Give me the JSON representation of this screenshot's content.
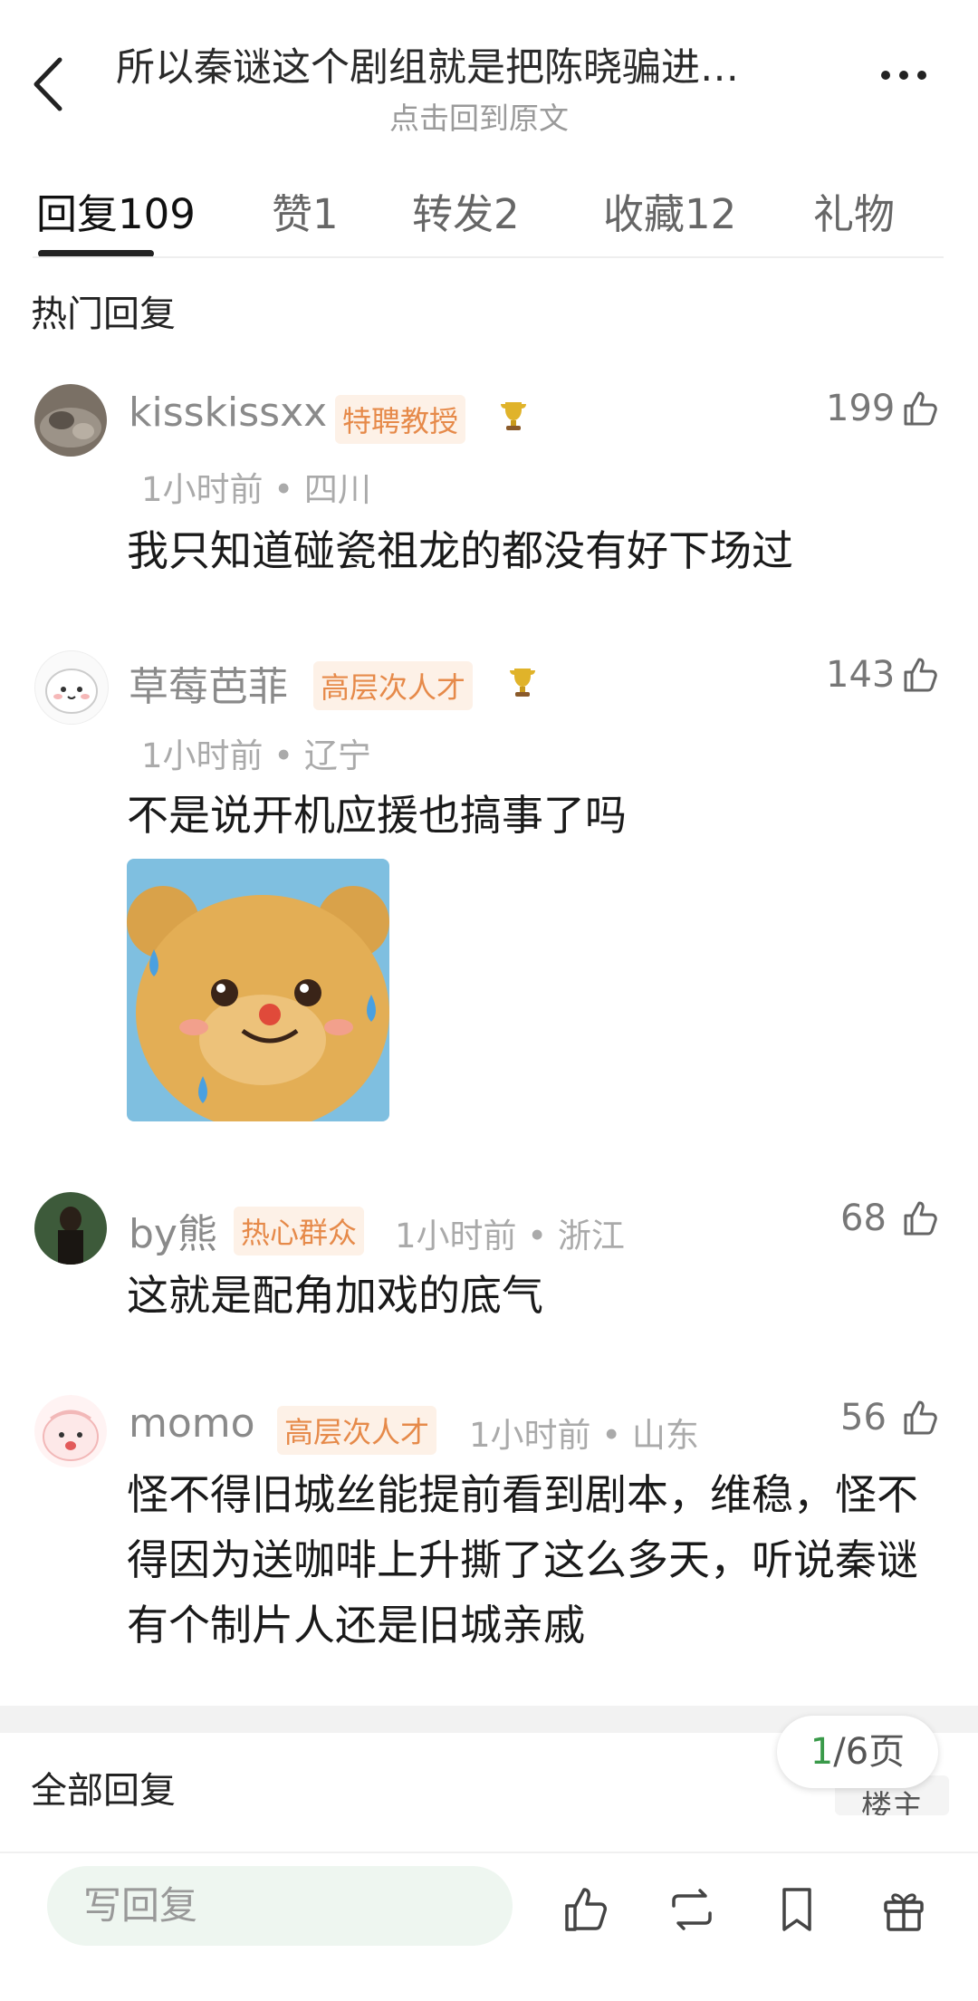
{
  "header": {
    "title": "所以秦谜这个剧组就是把陈晓骗进…",
    "subtitle": "点击回到原文"
  },
  "tabs": [
    {
      "label": "回复109"
    },
    {
      "label": "赞1"
    },
    {
      "label": "转发2"
    },
    {
      "label": "收藏12"
    },
    {
      "label": "礼物"
    }
  ],
  "section_label": "热门回复",
  "comments": [
    {
      "name": "kisskissxx",
      "badge": "特聘教授",
      "likes": "199",
      "meta": "1小时前 • 四川",
      "content": "我只知道碰瓷祖龙的都没有好下场过"
    },
    {
      "name": "草莓芭菲",
      "badge": "高层次人才",
      "likes": "143",
      "meta": "1小时前 • 辽宁",
      "content": "不是说开机应援也搞事了吗"
    },
    {
      "name": "by熊",
      "badge": "热心群众",
      "likes": "68",
      "meta": "1小时前 • 浙江",
      "content": "这就是配角加戏的底气"
    },
    {
      "name": "momo",
      "badge": "高层次人才",
      "likes": "56",
      "meta": "1小时前 • 山东",
      "content": "怪不得旧城丝能提前看到剧本，维稳，怪不得因为送咖啡上升撕了这么多天，听说秦谜有个制片人还是旧城亲戚"
    }
  ],
  "footer": {
    "all_replies": "全部回复",
    "page_current": "1",
    "page_total": "/6页",
    "louzhu": "楼主",
    "reply_placeholder": "写回复"
  },
  "colors": {
    "badge_text": "#e68a4a",
    "badge_bg": "#fdf1e7",
    "page_current": "#3a9a4a",
    "reply_bg": "#eef6f0"
  }
}
